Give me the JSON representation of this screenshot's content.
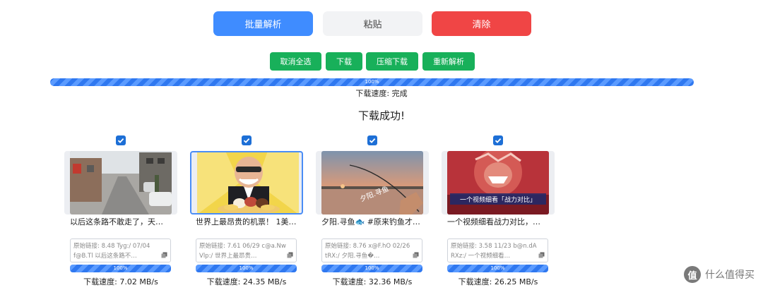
{
  "toolbar": {
    "batch_parse": "批量解析",
    "paste": "粘贴",
    "clear": "清除"
  },
  "actions": {
    "cancel_select_all": "取消全选",
    "download": "下载",
    "zip_download": "压缩下载",
    "reparse": "重新解析"
  },
  "overall": {
    "progress": 100,
    "progress_label": "100%",
    "speed_label": "下载速度: 完成",
    "status": "下载成功!"
  },
  "videos": [
    {
      "checked": true,
      "title": "以后这条路不敢走了，天…",
      "link_line1": "原始链接: 8.48 Tyg:/ 07/04",
      "link_line2": "f@B.Tl 以后这条路不…",
      "progress": 100,
      "progress_label": "100%",
      "speed": "下载速度: 7.02 MB/s"
    },
    {
      "checked": true,
      "selected": true,
      "title": "世界上最昂贵的机票！ 1美…",
      "link_line1": "原始链接: 7.61 06/29 c@a.Nw",
      "link_line2": "Vlp:/ 世界上最昂贵…",
      "progress": 100,
      "progress_label": "100%",
      "speed": "下载速度: 24.35 MB/s"
    },
    {
      "checked": true,
      "title": "夕阳.寻鱼🐟 #原来钓鱼才…",
      "thumb_text": "夕阳.寻鱼",
      "link_line1": "原始链接: 8.76 x@F.hO 02/26",
      "link_line2": "tRX:/ 夕阳.寻鱼�…",
      "progress": 100,
      "progress_label": "100%",
      "speed": "下载速度: 32.36 MB/s"
    },
    {
      "checked": true,
      "title": "一个视频细看战力对比，…",
      "thumb_text": "一个视频细看「战力对比」",
      "link_line1": "原始链接: 3.58 11/23 b@n.dA",
      "link_line2": "RXz:/ 一个视频细看…",
      "progress": 100,
      "progress_label": "100%",
      "speed": "下载速度: 26.25 MB/s"
    }
  ],
  "watermark": {
    "logo": "值",
    "text": "什么值得买"
  },
  "colors": {
    "primary": "#3f8cff",
    "danger": "#f04545",
    "success": "#18b05a",
    "progress": "#2f78f0"
  }
}
